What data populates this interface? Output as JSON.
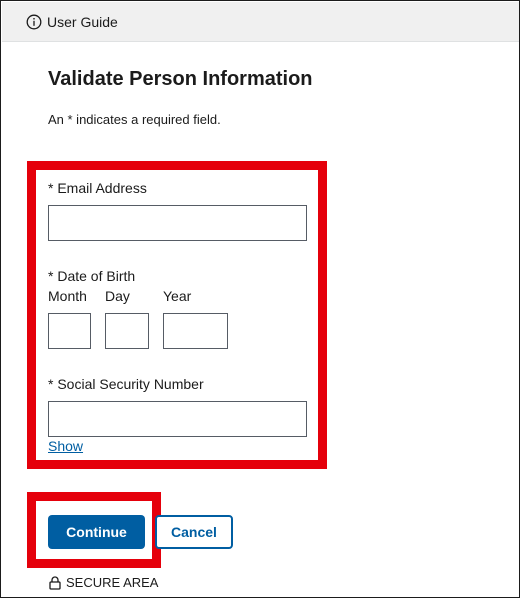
{
  "header": {
    "user_guide_label": "User Guide",
    "icon": "info-icon"
  },
  "page": {
    "title": "Validate Person Information",
    "required_hint": "An * indicates a required field."
  },
  "form": {
    "email": {
      "label": "* Email Address",
      "value": ""
    },
    "dob": {
      "label": "* Date of Birth",
      "month_label": "Month",
      "month_value": "",
      "day_label": "Day",
      "day_value": "",
      "year_label": "Year",
      "year_value": ""
    },
    "ssn": {
      "label": "* Social Security Number",
      "value": "",
      "show_label": "Show"
    }
  },
  "actions": {
    "continue_label": "Continue",
    "cancel_label": "Cancel"
  },
  "footer": {
    "secure_label": "SECURE AREA",
    "icon": "lock-icon"
  },
  "colors": {
    "primary": "#005ea2",
    "highlight": "#e5000b",
    "header_bg": "#f0f0f0"
  }
}
